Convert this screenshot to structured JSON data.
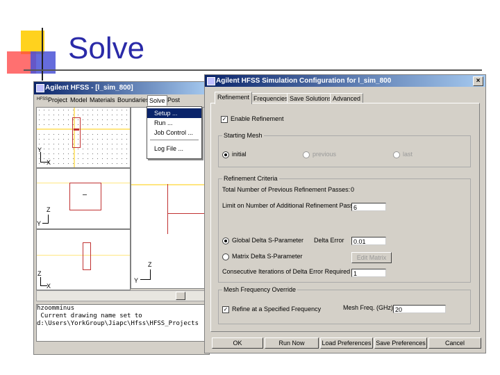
{
  "slide": {
    "title": "Solve"
  },
  "hfss": {
    "title": "Agilent HFSS - [l_sim_800]",
    "icon_text": "HFSS",
    "menu": [
      "Project",
      "Model",
      "Materials",
      "Boundaries",
      "Solve",
      "Post"
    ],
    "solve_menu": [
      "Setup ...",
      "Run ...",
      "Job Control ...",
      "Log File ..."
    ],
    "axes": {
      "x": "X",
      "y": "Y",
      "z": "Z"
    },
    "messages": "hzoomminus\n Current drawing name set to\nd:\\Users\\YorkGroup\\Jiapc\\Hfss\\HFSS_Projects"
  },
  "dialog": {
    "title": "Agilent HFSS Simulation Configuration for l_sim_800",
    "close": "×",
    "tabs": [
      "Refinement",
      "Frequencies",
      "Save Solutions",
      "Advanced"
    ],
    "enable_refinement": "Enable Refinement",
    "starting_mesh": {
      "caption": "Starting Mesh",
      "options": [
        "initial",
        "previous",
        "last"
      ]
    },
    "refinement_criteria": {
      "caption": "Refinement Criteria",
      "total_passes_label": "Total Number of Previous Refinement Passes:",
      "total_passes_value": "0",
      "limit_label": "Limit on Number of Additional Refinement Passes",
      "limit_value": "6",
      "global_delta_label": "Global Delta S-Parameter",
      "delta_error_label": "Delta Error",
      "delta_error_value": "0.01",
      "matrix_delta_label": "Matrix Delta S-Parameter",
      "edit_matrix": "Edit Matrix",
      "consecutive_label": "Consecutive Iterations of Delta Error Required",
      "consecutive_value": "1"
    },
    "mesh_override": {
      "caption": "Mesh Frequency Override",
      "refine_label": "Refine at a Specified Frequency",
      "freq_label": "Mesh Freq. (GHz)",
      "freq_value": "20"
    },
    "buttons": [
      "OK",
      "Run Now",
      "Load Preferences",
      "Save Preferences",
      "Cancel"
    ]
  },
  "colors": {
    "accent_title": "#2a2aa8",
    "window_title": "#0a246a",
    "face": "#d4d0c8"
  }
}
